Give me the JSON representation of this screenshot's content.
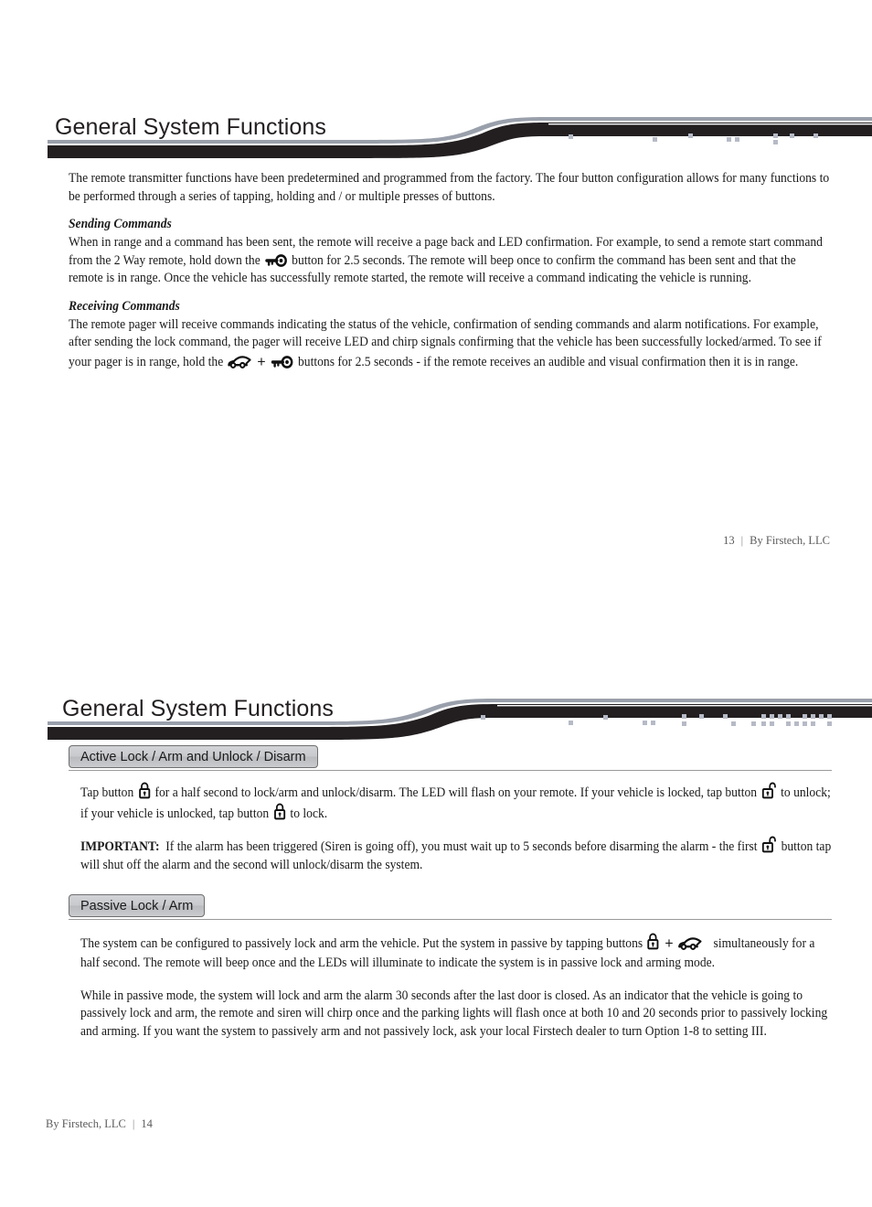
{
  "document": {
    "title": "General System Functions",
    "publisher": "By Firstech, LLC"
  },
  "page_13": {
    "header_title": "General System Functions",
    "intro": "The remote transmitter functions have been predetermined and programmed from the factory. The four button configuration allows for many functions to be performed through a series of tapping, holding and / or multiple presses of buttons.",
    "sending": {
      "heading": "Sending Commands",
      "text_before_icon": "When in range and a command has been sent, the remote will receive a page back and LED confirmation. For example, to send a remote start command from the 2 Way remote, hold down the",
      "icon": "key-icon",
      "text_after_icon": "button for 2.5 seconds. The remote will beep once to confirm the command has been sent and that the remote is in range. Once the vehicle has successfully remote started, the remote will receive a command indicating the vehicle is running."
    },
    "receiving": {
      "heading": "Receiving Commands",
      "text_before_icons": "The remote pager will receive commands indicating the status of the vehicle, confirmation of sending commands and alarm notifications. For example, after sending the lock command, the pager will receive LED and chirp signals confirming that the vehicle has been successfully locked/armed. To see if your pager is in range, hold the",
      "icon_first": "car-icon",
      "icon_plus": "+",
      "icon_second": "key-icon",
      "text_after_icons": "buttons for 2.5 seconds - if the remote receives an audible and visual confirmation then it is in range."
    },
    "footer": {
      "page_number": "13",
      "separator": "|",
      "publisher": "By Firstech, LLC"
    }
  },
  "page_14": {
    "header_title": "General System Functions",
    "section_active": {
      "tab_label": "Active Lock / Arm and Unlock / Disarm",
      "p1_a": "Tap button",
      "p1_icon1": "lock-icon",
      "p1_b": "for a half second to lock/arm and unlock/disarm. The LED will flash on your remote. If your vehicle is locked, tap button",
      "p1_icon2": "unlock-icon",
      "p1_c": "to unlock; if your vehicle is unlocked, tap button",
      "p1_icon3": "lock-icon",
      "p1_d": "to lock.",
      "p2_label": "IMPORTANT:",
      "p2_a": "If the alarm has been triggered (Siren is going off), you must wait up to 5 seconds before disarming the alarm - the first",
      "p2_icon": "unlock-icon",
      "p2_b": "button tap will shut off the alarm and the second will unlock/disarm the system."
    },
    "section_passive": {
      "tab_label": "Passive Lock / Arm",
      "p1_a": "The system can be configured to passively lock and arm the vehicle. Put the system in passive by tapping buttons",
      "p1_icon1": "lock-icon",
      "p1_plus": "+",
      "p1_icon2": "car-icon",
      "p1_b": "simultaneously for a half second. The remote will beep once and the LEDs will illuminate to indicate the system is in passive lock and arming mode.",
      "p2": "While in passive mode, the system will lock and arm the alarm 30 seconds after the last door is closed.  As an indicator that the vehicle is going to passively lock and arm, the remote and siren will chirp once and the parking lights will flash once at both 10 and 20 seconds prior to passively locking and arming. If you want the system to passively arm and not passively lock, ask your local Firstech dealer to turn Option 1-8 to setting III."
    },
    "footer": {
      "publisher": "By Firstech, LLC",
      "separator": "|",
      "page_number": "14"
    }
  },
  "colors": {
    "header_dark": "#231f20",
    "header_gray": "#9aa0ab",
    "dot_gray": "#b6bac6",
    "tab_fill": "#c8cacd",
    "tab_border": "#6f6f6f",
    "text": "#1a1a1a",
    "footer_text": "#5b5b5b"
  }
}
